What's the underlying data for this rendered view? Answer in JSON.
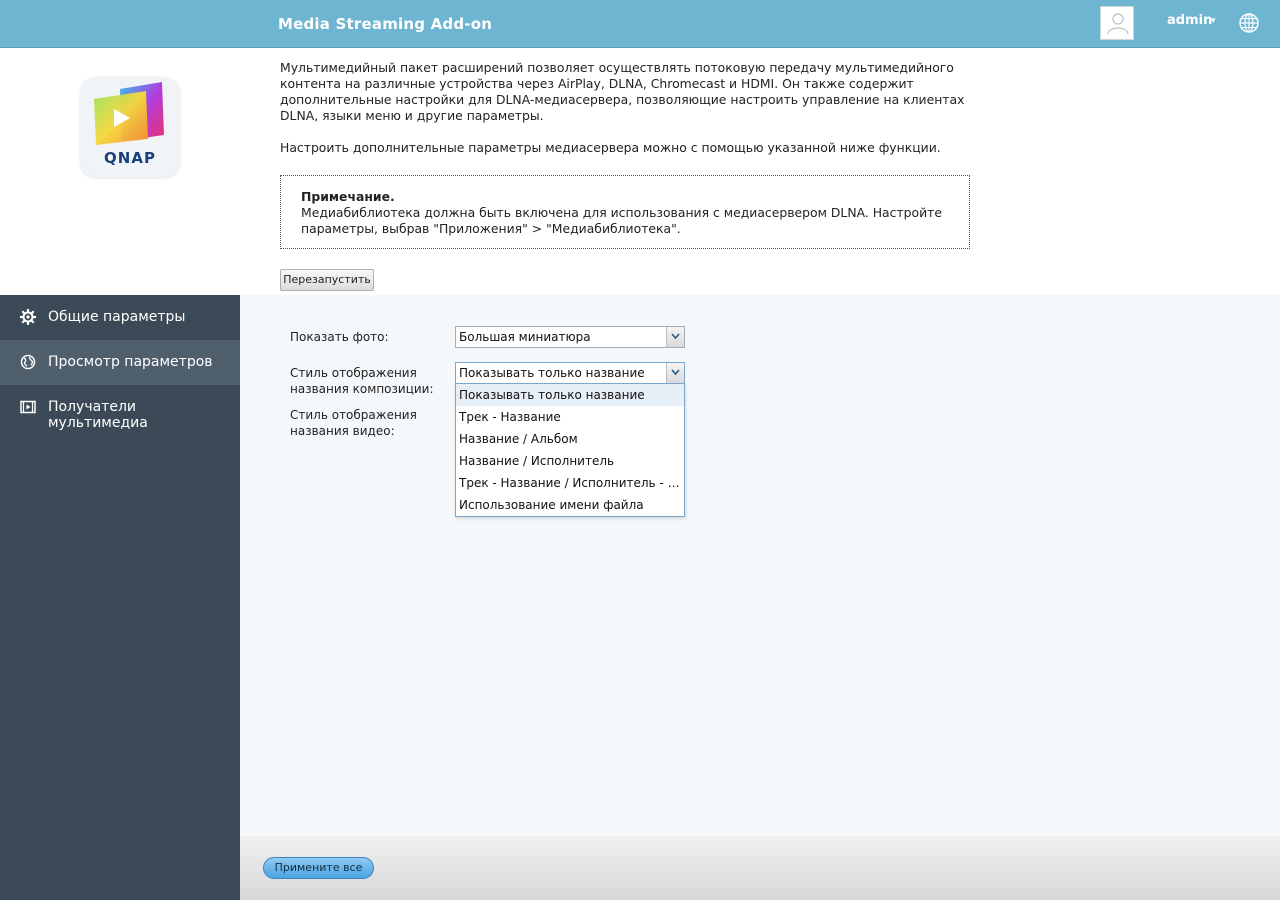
{
  "header": {
    "title": "Media Streaming Add-on",
    "user": "admin",
    "user_caret": "▾",
    "bg_color": "#6eb5d1"
  },
  "logo": {
    "text": "QNAP"
  },
  "description": {
    "paragraph1": "Мультимедийный пакет расширений позволяет осуществлять потоковую передачу мультимедийного контента на различные устройства через AirPlay, DLNA, Chromecast и HDMI. Он также содержит дополнительные настройки для DLNA-медиасервера, позволяющие настроить управление на клиентах DLNA, языки меню и другие параметры.",
    "paragraph2": "Настроить дополнительные параметры медиасервера можно с помощью указанной ниже функции."
  },
  "note": {
    "title": "Примечание.",
    "text": "Медиабиблиотека должна быть включена для использования с медиасервером DLNA. Настройте параметры, выбрав \"Приложения\" > \"Медиабиблиотека\"."
  },
  "restart_button": "Перезапустить",
  "sidebar": {
    "bg_color": "#3b4a56",
    "items": [
      {
        "label": "Общие параметры",
        "icon": "gear-icon",
        "active": false
      },
      {
        "label": "Просмотр параметров",
        "icon": "globe-icon",
        "active": true
      },
      {
        "label": "Получатели мультимедиа",
        "icon": "video-icon",
        "active": false
      }
    ]
  },
  "form": {
    "photo_label": "Показать фото:",
    "photo_value": "Большая миниатюра",
    "music_label_line1": "Стиль отображения",
    "music_label_line2": "названия композиции:",
    "music_value": "Показывать только название",
    "video_label_line1": "Стиль отображения",
    "video_label_line2": "названия видео:",
    "dropdown_options": [
      "Показывать только название",
      "Трек - Название",
      "Название / Альбом",
      "Название / Исполнитель",
      "Трек - Название / Исполнитель - Альбом",
      "Использование имени файла"
    ]
  },
  "footer": {
    "apply_button": "Примените все"
  }
}
